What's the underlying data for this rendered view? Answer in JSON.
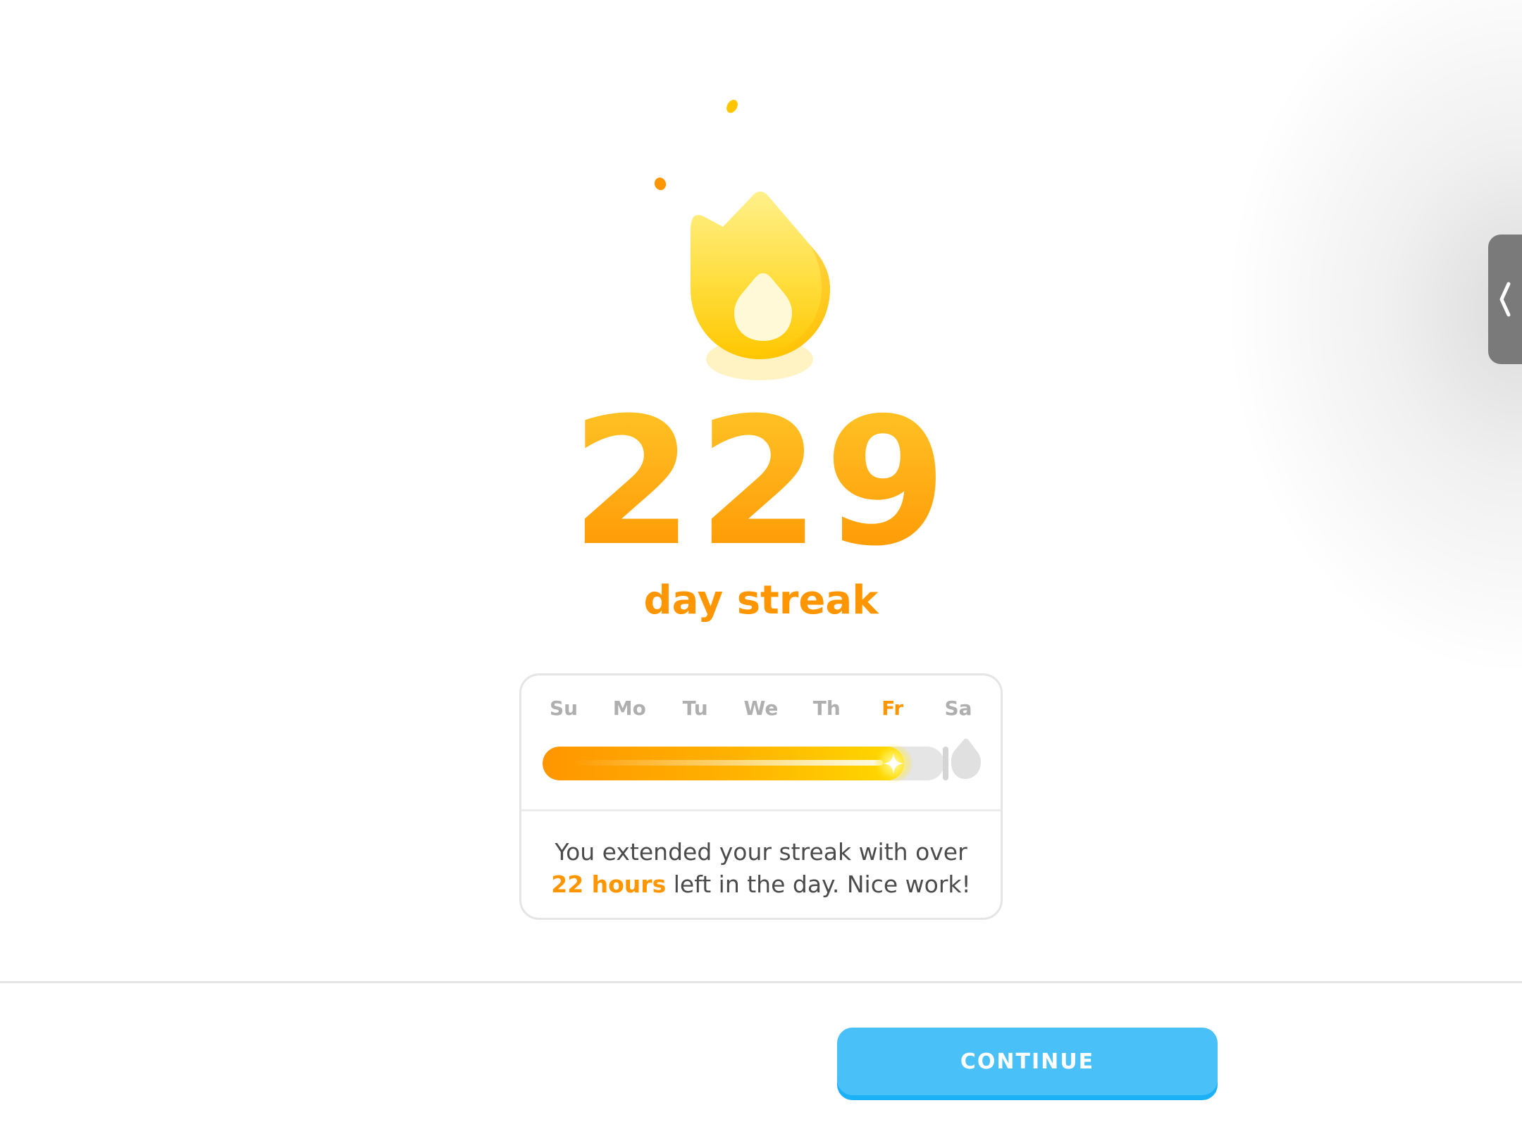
{
  "streak": {
    "count": "229",
    "label": "day streak"
  },
  "week": {
    "days": [
      "Su",
      "Mo",
      "Tu",
      "We",
      "Th",
      "Fr",
      "Sa"
    ],
    "active_day": "Fr",
    "progress_fraction": 0.9
  },
  "message": {
    "prefix": "You extended your streak with over",
    "highlight": "22 hours",
    "suffix": "left in the day. Nice work!"
  },
  "footer": {
    "continue_label": "CONTINUE"
  },
  "icons": {
    "hero": "streak-flame-icon",
    "progress_marker": "sparkle-icon",
    "future_day": "gray-flame-icon",
    "side_handle": "chevron-left-icon"
  },
  "colors": {
    "streak_orange": "#ff9600",
    "flame_yellow": "#ffd900",
    "button_blue": "#49c0f8",
    "inactive_gray": "#afafaf"
  }
}
